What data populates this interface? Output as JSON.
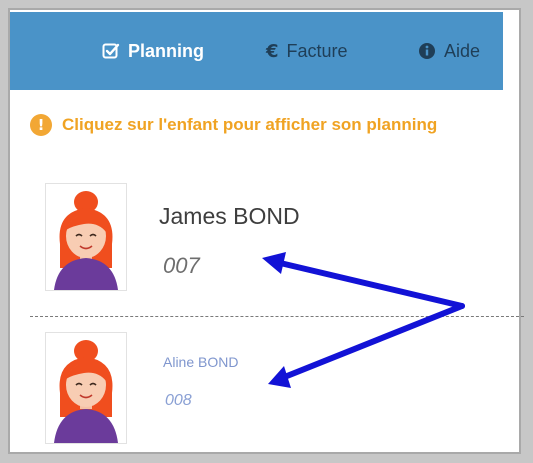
{
  "nav": {
    "items": [
      {
        "label": "Planning",
        "icon": "check-square-icon",
        "active": true
      },
      {
        "label": "Facture",
        "icon": "euro-icon",
        "active": false
      },
      {
        "label": "Aide",
        "icon": "info-circle-icon",
        "active": false
      }
    ]
  },
  "notice": {
    "text": "Cliquez sur l'enfant pour afficher son planning",
    "icon": "info-icon",
    "icon_glyph": "!"
  },
  "children": [
    {
      "name": "James BOND",
      "code": "007"
    },
    {
      "name": "Aline BOND",
      "code": "008"
    }
  ],
  "colors": {
    "nav_bg": "#4a93c8",
    "notice": "#f0a323",
    "annotation_arrow": "#1212d6"
  }
}
